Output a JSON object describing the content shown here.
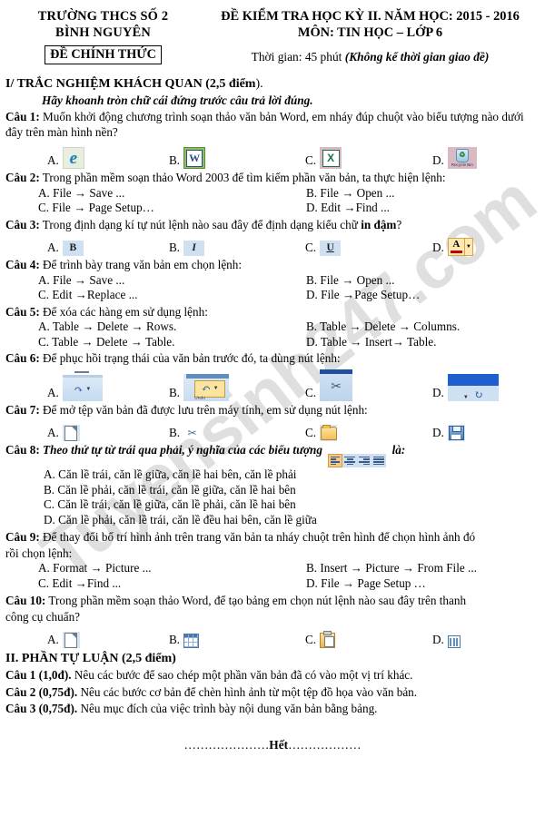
{
  "header": {
    "school_line1": "TRƯỜNG THCS SỐ 2",
    "school_line2": "BÌNH NGUYÊN",
    "official_badge": "ĐỀ CHÍNH THỨC",
    "exam_title": "ĐỀ KIỂM TRA HỌC KỲ II. NĂM HỌC: 2015 - 2016",
    "subject_line": "MÔN: TIN HỌC – LỚP 6",
    "time_label": "Thời gian: 45 phút",
    "time_note": "(Không kể thời gian giao đề)"
  },
  "part1": {
    "heading_bold": "I/ TRẮC NGHIỆM KHÁCH QUAN (2,5 điểm",
    "heading_tail": ").",
    "instruction": "Hãy khoanh tròn chữ cái đứng trước câu trả lời đúng."
  },
  "q1": {
    "label": "Câu 1:",
    "text": " Muốn khởi động chương trình soạn thảo văn bản Word, em nháy đúp chuột vào biểu tượng nào dưới đây trên màn hình nền?",
    "options": [
      {
        "letter": "A.",
        "icon": "internet-explorer-icon"
      },
      {
        "letter": "B.",
        "icon": "microsoft-word-icon"
      },
      {
        "letter": "C.",
        "icon": "microsoft-excel-icon"
      },
      {
        "letter": "D.",
        "icon": "recycle-bin-icon"
      }
    ],
    "bin_caption": "Recycle Bin"
  },
  "q2": {
    "label": "Câu 2:",
    "text": " Trong phần mềm soạn thảo Word 2003 để tìm kiếm phần văn bản, ta thực hiện lệnh:",
    "options": [
      "A. File → Save ...",
      "B. File → Open ...",
      "C. File → Page Setup…",
      "D. Edit →Find ..."
    ]
  },
  "q3": {
    "label": "Câu 3:",
    "text_pre": " Trong định dạng kí tự nút lệnh nào sau đây để định dạng kiểu chữ ",
    "text_bold": "in đậm",
    "text_post": "?",
    "options": [
      {
        "letter": "A.",
        "icon": "bold-icon",
        "glyph": "B"
      },
      {
        "letter": "B.",
        "icon": "italic-icon",
        "glyph": "I"
      },
      {
        "letter": "C.",
        "icon": "underline-icon",
        "glyph": "U"
      },
      {
        "letter": "D.",
        "icon": "font-color-icon",
        "glyph": "A"
      }
    ]
  },
  "q4": {
    "label": "Câu 4:",
    "text": " Để trình bày trang văn bản em chọn lệnh:",
    "options": [
      "A. File → Save ...",
      "B. File → Open ...",
      "C. Edit →Replace ...",
      "D. File →Page Setup…"
    ]
  },
  "q5": {
    "label": "Câu 5:",
    "text": " Để xóa các hàng em sử dụng lệnh:",
    "options": [
      "A. Table → Delete → Rows.",
      "B. Table → Delete → Columns.",
      "C. Table → Delete → Table.",
      "D. Table → Insert→ Table."
    ]
  },
  "q6": {
    "label": "Câu 6:",
    "text": " Để phục hồi trạng thái của văn bản trước đó, ta dùng nút lệnh:",
    "options": [
      {
        "letter": "A.",
        "icon": "redo-toolbar-icon"
      },
      {
        "letter": "B.",
        "icon": "undo-toolbar-icon",
        "sub_caption": "Undo"
      },
      {
        "letter": "C.",
        "icon": "cut-scissors-icon"
      },
      {
        "letter": "D.",
        "icon": "redo-blue-toolbar-icon"
      }
    ]
  },
  "q7": {
    "label": "Câu  7:",
    "text": " Để mở tệp văn bản đã được lưu trên máy tính, em sử dụng nút lệnh:",
    "options": [
      {
        "letter": "A.",
        "icon": "new-document-icon"
      },
      {
        "letter": "B.",
        "icon": "cut-icon"
      },
      {
        "letter": "C.",
        "icon": "open-folder-icon"
      },
      {
        "letter": "D.",
        "icon": "save-disk-icon"
      }
    ]
  },
  "q8": {
    "label": "Câu 8:",
    "text_pre": " Theo thứ tự từ trái qua phải, ý nghĩa của các biểu tượng ",
    "text_post": " là:",
    "icons": [
      "align-left-icon",
      "align-center-icon",
      "align-right-icon",
      "align-justify-icon"
    ],
    "options": [
      "A. Căn lề trái,  căn lề giữa,  căn lề hai bên,  căn lề phải",
      "B. Căn lề phải,  căn lề trái,  căn lề giữa,  căn lề hai bên",
      "C. Căn lề trái,  căn lề giữa,  căn lề phải,  căn lề hai bên",
      "D. Căn lề phải,  căn lề trái, căn lề đều hai bên,  căn lề giữa"
    ]
  },
  "q9": {
    "label": "Câu 9:",
    "text_line1": "  Để thay đổi bố trí hình ảnh trên trang văn bản  ta nháy chuột trên hình để  chọn hình ảnh đó",
    "text_line2": "rồi chọn lệnh:",
    "options": [
      "A. Format → Picture ...",
      "B. Insert → Picture → From File ...",
      "C. Edit →Find ...",
      "D. File → Page Setup …"
    ]
  },
  "q10": {
    "label": "Câu 10:",
    "text_line1": " Trong phần mềm soạn thảo Word, để tạo bảng  em chọn nút lệnh nào sau đây trên thanh",
    "text_line2": "công cụ  chuẩn?",
    "options": [
      {
        "letter": "A.",
        "icon": "new-document-icon"
      },
      {
        "letter": "B.",
        "icon": "insert-table-icon"
      },
      {
        "letter": "C.",
        "icon": "paste-icon"
      },
      {
        "letter": "D.",
        "icon": "columns-icon"
      }
    ]
  },
  "part2": {
    "heading": "II. PHẦN TỰ LUẬN (2,5 điểm)",
    "questions": [
      {
        "label": "Câu 1 (1,0đ).",
        "text": " Nêu các bước để sao chép một phần văn bản đã có vào một vị trí khác."
      },
      {
        "label": "Câu 2 (0,75đ).",
        "text": " Nêu các bước cơ bản để chèn hình ảnh từ một tệp đồ họa vào văn bản."
      },
      {
        "label": "Câu 3 (0,75đ).",
        "text": " Nêu mục đích của việc trình bày nội dung văn bản bằng bảng."
      }
    ]
  },
  "footer": {
    "dots_left": "…………………",
    "end_word": "Hết",
    "dots_right": "………………"
  },
  "watermark": {
    "text": "Tuyensinh247.com",
    "color": "#d9d9d9"
  }
}
